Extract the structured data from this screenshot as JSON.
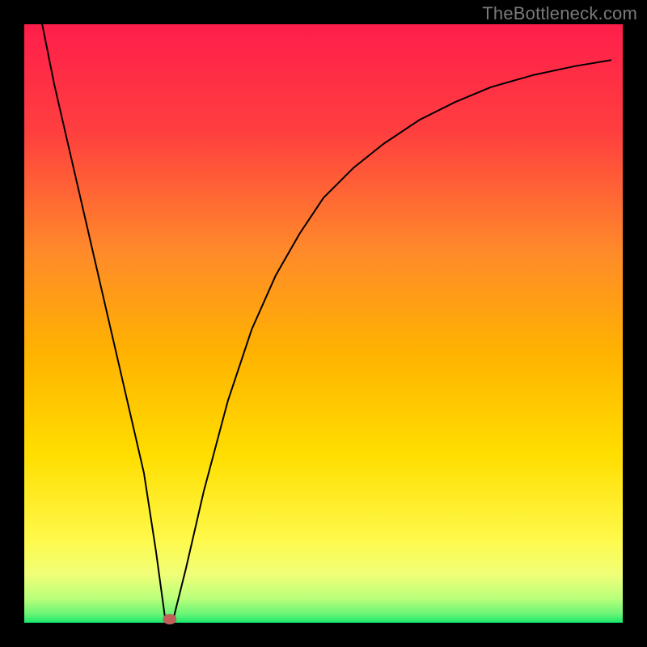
{
  "watermark": "TheBottleneck.com",
  "chart_data": {
    "type": "line",
    "title": "",
    "xlabel": "",
    "ylabel": "",
    "xlim": [
      0,
      100
    ],
    "ylim": [
      0,
      100
    ],
    "background_gradient": {
      "top": "#ff1e4b",
      "mid_upper": "#ff6a2c",
      "mid": "#ffb300",
      "mid_lower": "#ffe400",
      "lower": "#f6ff6e",
      "bottom": "#17e86a"
    },
    "frame_color": "#000000",
    "note": "Axes have no tick labels or numeric scale in the source image; values below are normalized 0–100 estimates read from pixel positions.",
    "series": [
      {
        "name": "bottleneck-curve",
        "x": [
          3,
          5,
          8,
          11,
          14,
          17,
          20,
          22,
          23.5,
          25,
          27,
          30,
          34,
          38,
          42,
          46,
          50,
          55,
          60,
          66,
          72,
          78,
          85,
          92,
          98
        ],
        "y": [
          100,
          90,
          77,
          64,
          51,
          38,
          25,
          12,
          1,
          1,
          9,
          22,
          37,
          49,
          58,
          65,
          71,
          76,
          80,
          84,
          87,
          89.5,
          91.5,
          93,
          94
        ]
      }
    ],
    "marker": {
      "name": "selected-point",
      "x": 24.3,
      "y": 0.6,
      "color": "#c0605a"
    }
  }
}
